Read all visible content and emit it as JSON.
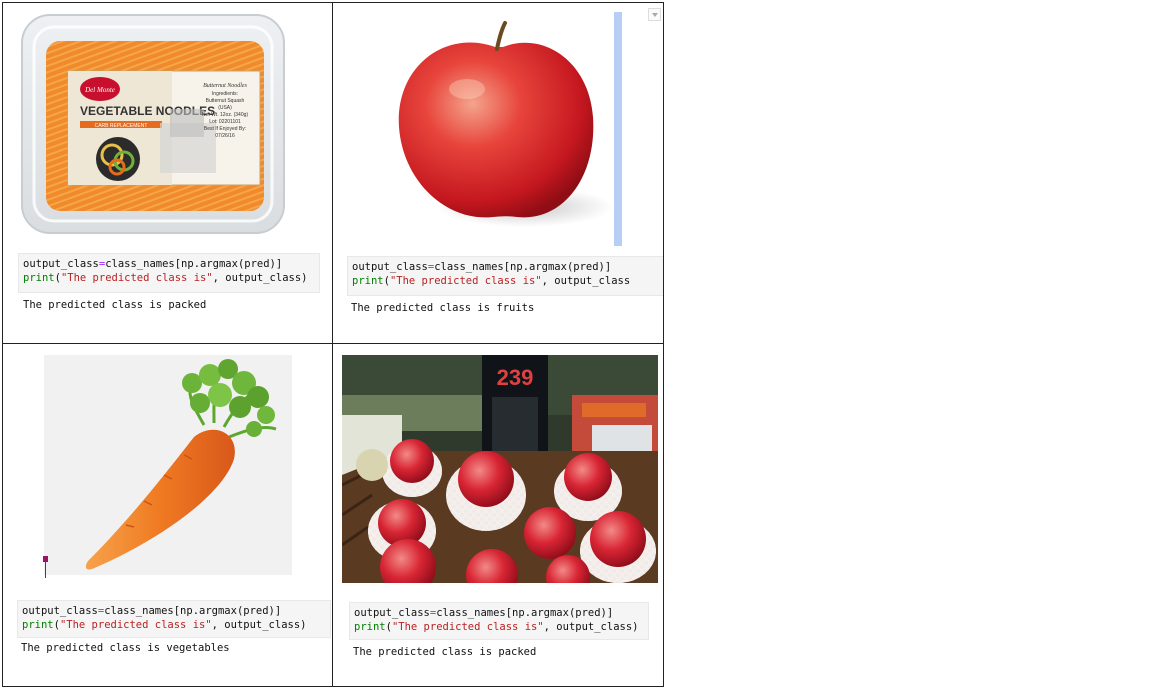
{
  "cells": [
    {
      "image": "vegetable-noodles-package",
      "code_line1_a": "output_class",
      "code_line1_op": "=",
      "code_line1_b": "class_names[np.argmax(pred)]",
      "code_line2_fn": "print",
      "code_line2_paren": "(",
      "code_line2_str": "\"The predicted class is\"",
      "code_line2_rest": ", output_class)",
      "output": "The predicted class is packed",
      "package": {
        "brand": "Del Monte",
        "title": "VEGETABLE NOODLES",
        "subtitle": "CARB REPLACEMENT",
        "label_lines": [
          "Butternut Noodles",
          "Ingredients:",
          "Butternut Squash",
          "(USA)",
          "Net Wt. 12oz. (340g)",
          "Lot: 02201101",
          "Best If Enjoyed By:",
          "07/26/16"
        ]
      }
    },
    {
      "image": "red-apple",
      "code_line1_a": "output_class",
      "code_line1_op": "=",
      "code_line1_b": "class_names[np.argmax(pred)]",
      "code_line2_fn": "print",
      "code_line2_paren": "(",
      "code_line2_str": "\"The predicted class is\"",
      "code_line2_rest": ", output_class",
      "output": "The predicted class is fruits"
    },
    {
      "image": "carrot",
      "code_line1_a": "output_class",
      "code_line1_op": "=",
      "code_line1_b": "class_names[np.argmax(pred)]",
      "code_line2_fn": "print",
      "code_line2_paren": "(",
      "code_line2_str": "\"The predicted class is\"",
      "code_line2_rest": ", output_class)",
      "output": "The predicted class is vegetables"
    },
    {
      "image": "apples-in-store",
      "code_line1_a": "output_class",
      "code_line1_op": "=",
      "code_line1_b": "class_names[np.argmax(pred)]",
      "code_line2_fn": "print",
      "code_line2_paren": "(",
      "code_line2_str": "\"The predicted class is\"",
      "code_line2_rest": ", output_class)",
      "output": "The predicted class is packed",
      "price_sign": "239"
    }
  ],
  "colors": {
    "keyword": "#008000",
    "string": "#ba2121",
    "operator": "#aa22ff",
    "scrollbar": "#b8cff5",
    "cursor_marker": "#a0106a"
  }
}
